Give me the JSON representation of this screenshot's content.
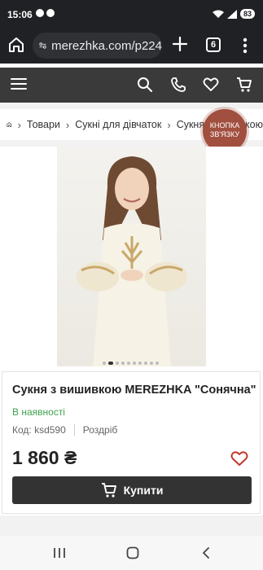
{
  "statusbar": {
    "time": "15:06",
    "battery": "83"
  },
  "browser": {
    "url": "merezhka.com/p224",
    "tab_count": "6"
  },
  "breadcrumb": {
    "items": [
      "Товари",
      "Сукні для дівчаток",
      "Сукня з вишивкою"
    ]
  },
  "call_button": {
    "label": "КНОПКА ЗВ'ЯЗКУ"
  },
  "product": {
    "title": "Сукня з вишивкою MEREZHKA \"Сонячна\"",
    "availability": "В наявності",
    "code": "Код: ksd590",
    "sale_type": "Роздріб",
    "price": "1 860 ₴",
    "buy_label": "Купити",
    "image_count": 10,
    "active_image": 1
  },
  "colors": {
    "accent": "#a14f3f",
    "dark": "#3a3a3a",
    "stock": "#3fa34d",
    "heart": "#c0392b"
  },
  "icons": {
    "site": [
      "menu-icon",
      "search-icon",
      "phone-icon",
      "heart-icon",
      "cart-icon"
    ],
    "nav": [
      "recent-apps-icon",
      "home-icon",
      "back-icon"
    ]
  }
}
